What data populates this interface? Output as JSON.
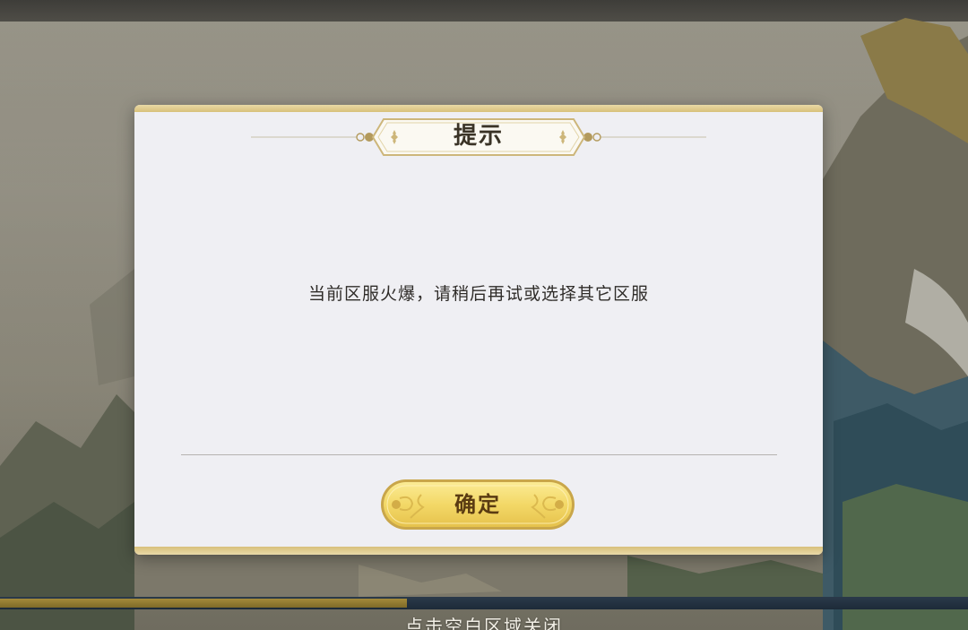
{
  "dialog": {
    "title": "提示",
    "message": "当前区服火爆，请稍后再试或选择其它区服",
    "confirm_label": "确定"
  },
  "footer": {
    "hint": "点击空白区域关闭"
  },
  "loading": {
    "progress_fraction": 0.42
  },
  "colors": {
    "dialog_bg": "#efeff3",
    "gold_accent": "#d8c07a",
    "button_gold": "#f0d765",
    "progress_fill": "#a48a3a",
    "progress_track": "#1d2a38"
  }
}
